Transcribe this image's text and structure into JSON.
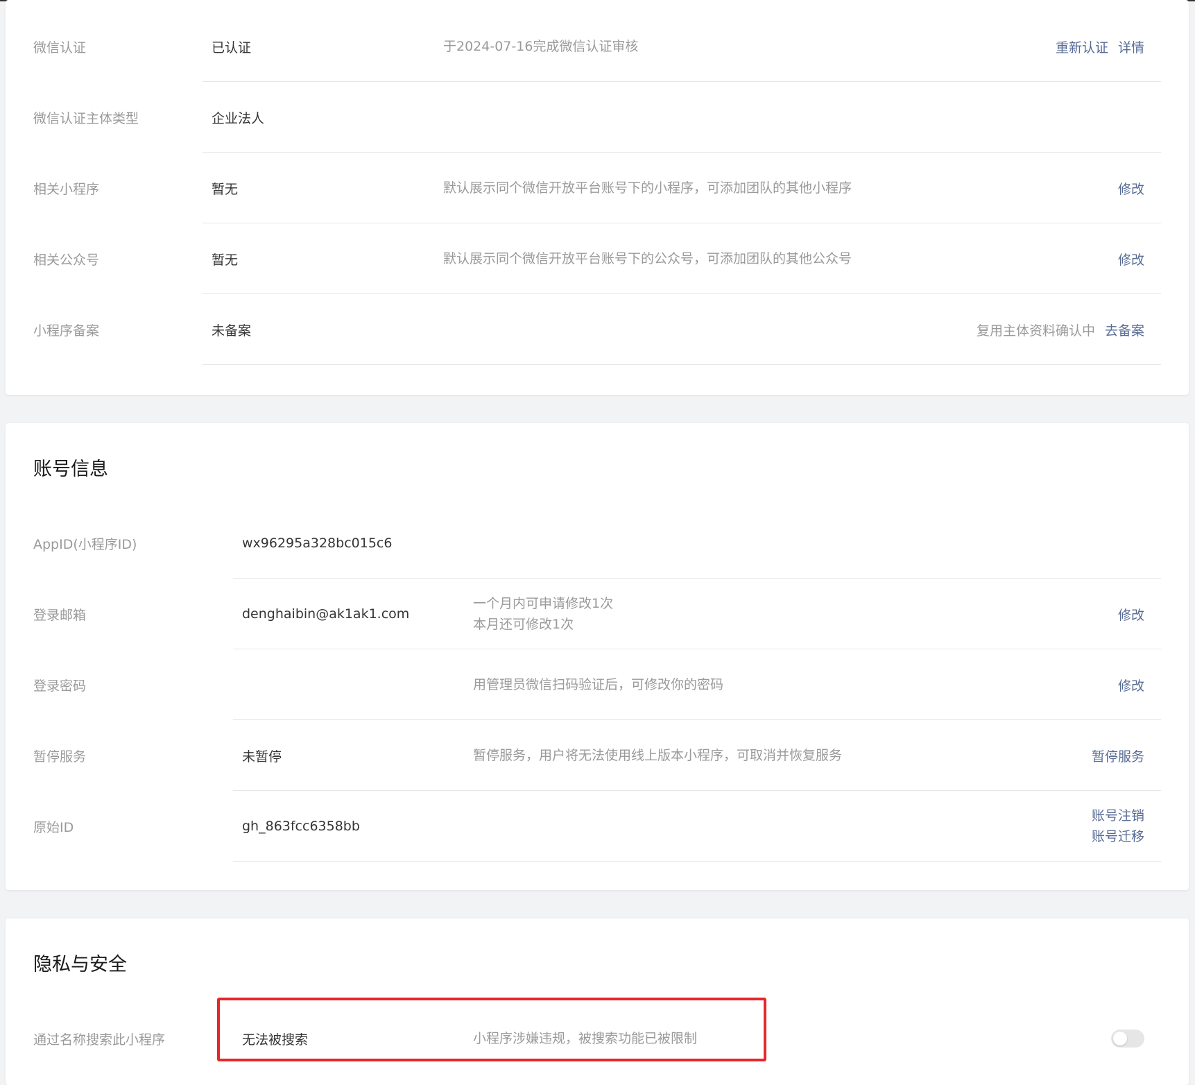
{
  "certification_section": {
    "rows": [
      {
        "label": "微信认证",
        "value": "已认证",
        "desc": "于2024-07-16完成微信认证审核",
        "actions": [
          "重新认证",
          "详情"
        ]
      },
      {
        "label": "微信认证主体类型",
        "value": "企业法人",
        "desc": "",
        "actions": []
      },
      {
        "label": "相关小程序",
        "value": "暂无",
        "desc": "默认展示同个微信开放平台账号下的小程序，可添加团队的其他小程序",
        "actions": [
          "修改"
        ]
      },
      {
        "label": "相关公众号",
        "value": "暂无",
        "desc": "默认展示同个微信开放平台账号下的公众号，可添加团队的其他公众号",
        "actions": [
          "修改"
        ]
      },
      {
        "label": "小程序备案",
        "value": "未备案",
        "desc": "",
        "status": "复用主体资料确认中",
        "actions": [
          "去备案"
        ]
      }
    ]
  },
  "account_section": {
    "title": "账号信息",
    "rows": [
      {
        "label": "AppID(小程序ID)",
        "value": "wx96295a328bc015c6",
        "desc_lines": [],
        "actions": []
      },
      {
        "label": "登录邮箱",
        "value": "denghaibin@ak1ak1.com",
        "desc_lines": [
          "一个月内可申请修改1次",
          "本月还可修改1次"
        ],
        "actions": [
          "修改"
        ]
      },
      {
        "label": "登录密码",
        "value": "",
        "desc_lines": [
          "用管理员微信扫码验证后，可修改你的密码"
        ],
        "actions": [
          "修改"
        ]
      },
      {
        "label": "暂停服务",
        "value": "未暂停",
        "desc_lines": [
          "暂停服务，用户将无法使用线上版本小程序，可取消并恢复服务"
        ],
        "actions": [
          "暂停服务"
        ]
      },
      {
        "label": "原始ID",
        "value": "gh_863fcc6358bb",
        "desc_lines": [],
        "actions": [
          "账号注销",
          "账号迁移"
        ]
      }
    ]
  },
  "privacy_section": {
    "title": "隐私与安全",
    "rows": [
      {
        "label": "通过名称搜索此小程序",
        "value": "无法被搜索",
        "desc": "小程序涉嫌违规，被搜索功能已被限制",
        "toggle_on": false
      }
    ]
  },
  "colors": {
    "link": "#576b95",
    "muted": "#9a9a9a",
    "highlight": "#e8262a"
  }
}
